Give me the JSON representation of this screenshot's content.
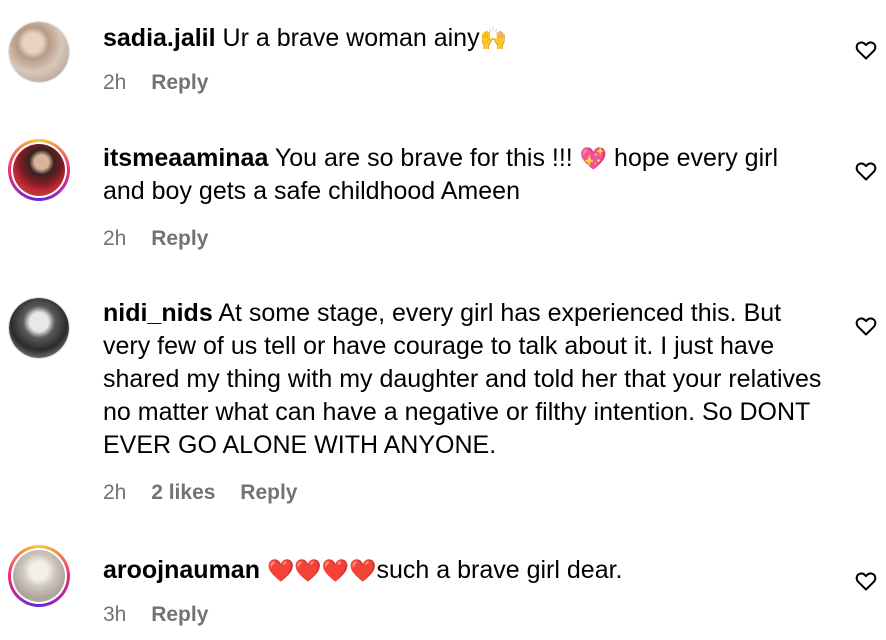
{
  "comments": [
    {
      "username": "sadia.jalil",
      "text": "Ur a brave woman ainy",
      "emoji": "🙌",
      "time": "2h",
      "likes": "",
      "reply": "Reply"
    },
    {
      "username": "itsmeaaminaa",
      "text": "You are so brave for this !!! ",
      "emoji": "💖",
      "text2": " hope every girl and boy gets a safe childhood Ameen",
      "time": "2h",
      "likes": "",
      "reply": "Reply"
    },
    {
      "username": "nidi_nids",
      "text": "At some stage, every girl has experienced this. But very few of us tell or have courage to talk about it. I just have shared my thing with my daughter and told her that your relatives no matter what can have a negative or filthy intention. So DONT EVER GO ALONE WITH ANYONE.",
      "time": "2h",
      "likes": "2 likes",
      "reply": "Reply"
    },
    {
      "username": "aroojnauman",
      "emoji": "❤️❤️❤️❤️",
      "text": "such a brave girl dear.",
      "time": "3h",
      "likes": "",
      "reply": "Reply"
    }
  ],
  "colors": {
    "meta": "#737373",
    "story_ring": [
      "#f9ce34",
      "#ee2a7b",
      "#6228d7"
    ]
  },
  "icons": {
    "like": "heart-outline-icon"
  }
}
